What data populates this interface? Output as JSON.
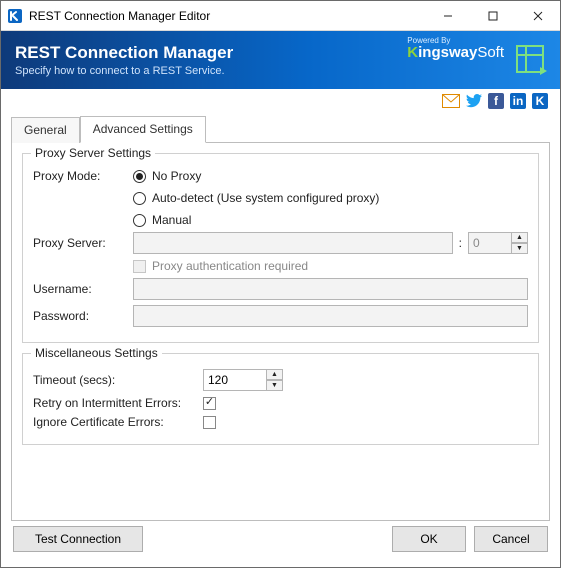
{
  "window": {
    "title": "REST Connection Manager Editor"
  },
  "banner": {
    "title": "REST Connection Manager",
    "subtitle": "Specify how to connect to a REST Service.",
    "powered": "Powered By",
    "brand": "KingswaySoft"
  },
  "tabs": {
    "general": "General",
    "advanced": "Advanced Settings",
    "active": "advanced"
  },
  "proxy": {
    "legend": "Proxy Server Settings",
    "mode_label": "Proxy Mode:",
    "opt_no": "No Proxy",
    "opt_auto": "Auto-detect (Use system configured proxy)",
    "opt_manual": "Manual",
    "selected": "no",
    "server_label": "Proxy Server:",
    "server_value": "",
    "port_value": "0",
    "auth_label": "Proxy authentication required",
    "auth_checked": false,
    "user_label": "Username:",
    "user_value": "",
    "pass_label": "Password:",
    "pass_value": ""
  },
  "misc": {
    "legend": "Miscellaneous Settings",
    "timeout_label": "Timeout (secs):",
    "timeout_value": "120",
    "retry_label": "Retry on Intermittent Errors:",
    "retry_checked": true,
    "ignore_label": "Ignore Certificate Errors:",
    "ignore_checked": false
  },
  "footer": {
    "test": "Test Connection",
    "ok": "OK",
    "cancel": "Cancel"
  }
}
